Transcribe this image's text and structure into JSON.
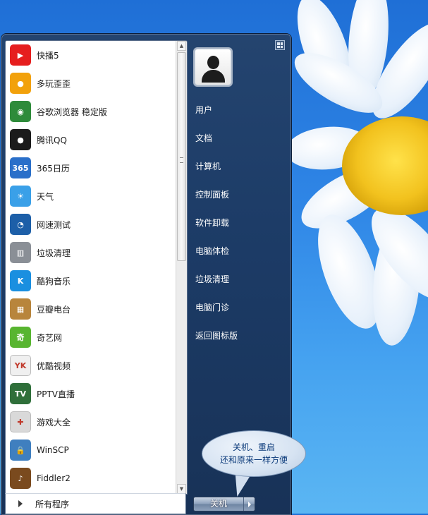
{
  "programs": [
    {
      "label": "快播5",
      "icon": "qvod-icon",
      "color": "#e61e1e",
      "glyph": "▶"
    },
    {
      "label": "多玩歪歪",
      "icon": "yy-bear-icon",
      "color": "#f2a10b",
      "glyph": "●"
    },
    {
      "label": "谷歌浏览器 稳定版",
      "icon": "chrome-icon",
      "color": "#2e8b3a",
      "glyph": "◉"
    },
    {
      "label": "腾讯QQ",
      "icon": "qq-penguin-icon",
      "color": "#1b1b1b",
      "glyph": "●"
    },
    {
      "label": "365日历",
      "icon": "calendar-icon",
      "color": "#2a6fc9",
      "glyph": "365"
    },
    {
      "label": "天气",
      "icon": "weather-icon",
      "color": "#3aa0e8",
      "glyph": "☀"
    },
    {
      "label": "网速测试",
      "icon": "speedometer-icon",
      "color": "#1d5fa8",
      "glyph": "◔"
    },
    {
      "label": "垃圾清理",
      "icon": "trash-bin-icon",
      "color": "#8a8f96",
      "glyph": "▥"
    },
    {
      "label": "酷狗音乐",
      "icon": "kugou-icon",
      "color": "#1a8fe0",
      "glyph": "K"
    },
    {
      "label": "豆瓣电台",
      "icon": "radio-icon",
      "color": "#b8853c",
      "glyph": "▦"
    },
    {
      "label": "奇艺网",
      "icon": "qiyi-icon",
      "color": "#58b530",
      "glyph": "奇"
    },
    {
      "label": "优酷视频",
      "icon": "youku-icon",
      "color": "#f0f0f0",
      "glyph": "YK"
    },
    {
      "label": "PPTV直播",
      "icon": "pptv-icon",
      "color": "#2f6f3a",
      "glyph": "TV"
    },
    {
      "label": "游戏大全",
      "icon": "gamepad-icon",
      "color": "#d9d9d9",
      "glyph": "✚"
    },
    {
      "label": "WinSCP",
      "icon": "lock-transfer-icon",
      "color": "#3f7fbf",
      "glyph": "🔒"
    },
    {
      "label": "Fiddler2",
      "icon": "violin-icon",
      "color": "#7a4a1e",
      "glyph": "♪"
    }
  ],
  "all_programs_label": "所有程序",
  "right_items": [
    "用户",
    "文档",
    "计算机",
    "控制面板",
    "软件卸载",
    "电脑体检",
    "垃圾清理",
    "电脑门诊",
    "返回图标版"
  ],
  "shutdown_label": "关机",
  "callout": {
    "line1": "关机、重启",
    "line2": "还和原来一样方便"
  }
}
